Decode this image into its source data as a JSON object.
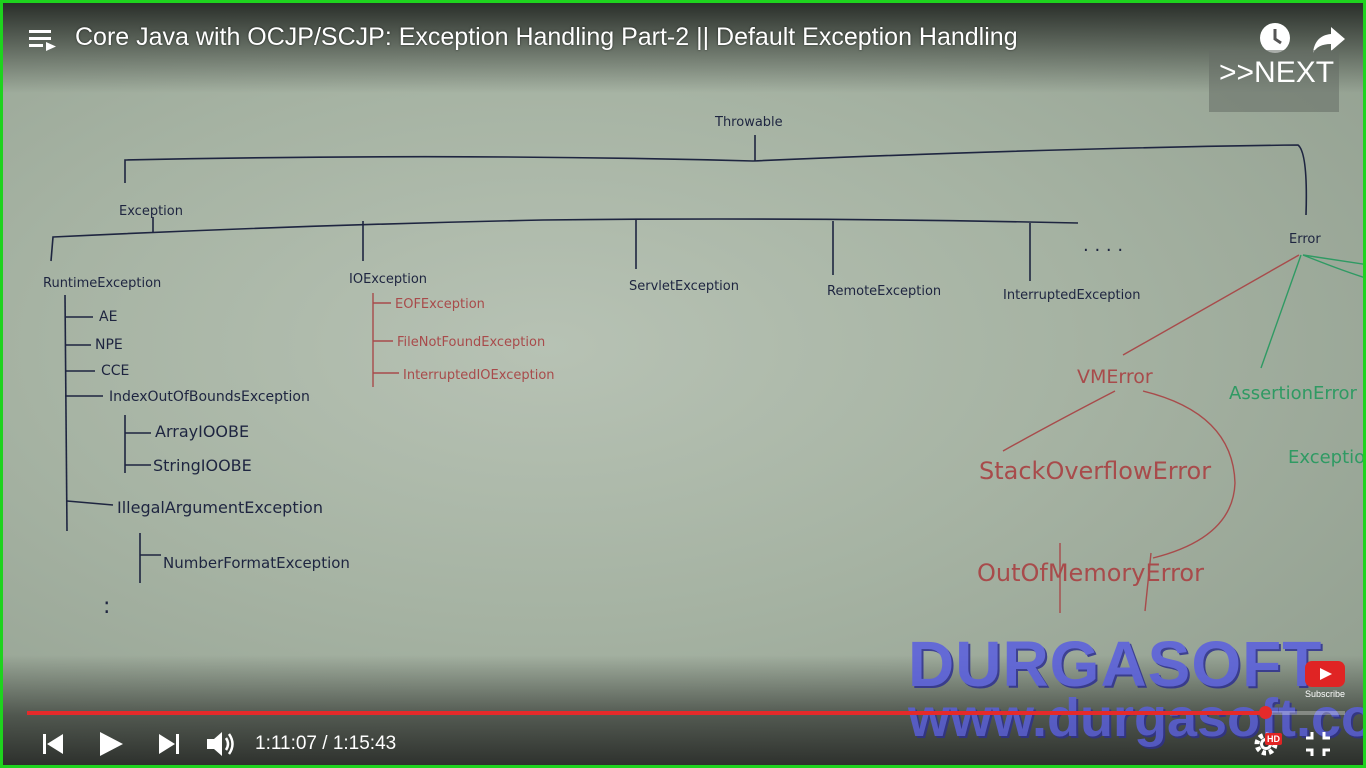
{
  "player": {
    "title": "Core Java with OCJP/SCJP: Exception Handling Part-2 || Default Exception Handling",
    "next_label": ">>NEXT",
    "time_display": "1:11:07 / 1:15:43",
    "progress_fraction": 0.939,
    "hd_badge": "HD",
    "subscribe_label": "Subscribe",
    "frame_color": "#1ed31e",
    "progress_color": "#e52a2a",
    "icons": [
      "playlist-icon",
      "watch-later-icon",
      "share-icon",
      "previous-icon",
      "play-icon",
      "next-icon",
      "volume-icon",
      "settings-icon",
      "exit-fullscreen-icon"
    ]
  },
  "watermark": {
    "brand": "DURGASOFT",
    "url": "www.durgasoft.com"
  },
  "whiteboard": {
    "root": "Throwable",
    "exception": "Exception",
    "error": "Error",
    "ellipsis": ". . . .",
    "runtime": "RuntimeException",
    "runtime_children": [
      "AE",
      "NPE",
      "CCE",
      "IndexOutOfBoundsException"
    ],
    "ioobe_children": [
      "ArrayIOOBE",
      "StringIOOBE"
    ],
    "illegal_arg": "IllegalArgumentException",
    "number_format": "NumberFormatException",
    "io": "IOException",
    "io_children": [
      "EOFException",
      "FileNotFoundException",
      "InterruptedIOException"
    ],
    "servlet": "ServletException",
    "remote": "RemoteException",
    "interrupted": "InterruptedException",
    "vm_error": "VMError",
    "vm_children": [
      "StackOverflowError",
      "OutOfMemoryError"
    ],
    "assertion": "AssertionError",
    "exception_in": "Exception"
  }
}
